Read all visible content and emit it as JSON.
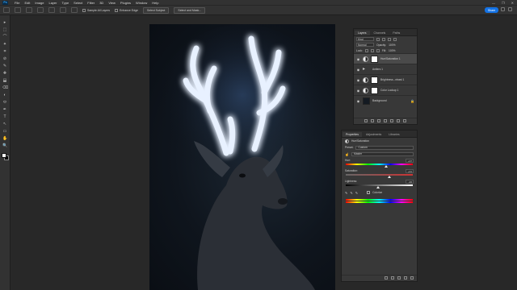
{
  "app": {
    "logo": "Ps"
  },
  "menu": [
    "File",
    "Edit",
    "Image",
    "Layer",
    "Type",
    "Select",
    "Filter",
    "3D",
    "View",
    "Plugins",
    "Window",
    "Help"
  ],
  "window_controls": [
    "—",
    "❐",
    "✕"
  ],
  "options_bar": {
    "sample_all_layers": "Sample All Layers",
    "enhance_edge": "Enhance Edge",
    "select_subject": "Select Subject",
    "select_and_mask": "Select and Mask...",
    "share": "Share"
  },
  "tools": [
    "▸",
    "⬚",
    "⌒",
    "✦",
    "⌗",
    "⊘",
    "✎",
    "✚",
    "⬓",
    "⌫",
    "◐",
    "⬭",
    "✒",
    "T",
    "↖",
    "▭",
    "✋",
    "🔍"
  ],
  "layers_panel": {
    "tabs": [
      "Layers",
      "Channels",
      "Paths"
    ],
    "kind_label": "Kind",
    "blend_mode": "Normal",
    "opacity_label": "Opacity:",
    "opacity_value": "100%",
    "lock_label": "Lock:",
    "fill_label": "Fill:",
    "fill_value": "100%",
    "layers": [
      {
        "name": "Hue/Saturation 1",
        "type": "adjustment",
        "active": true
      },
      {
        "name": "Antlers 1",
        "type": "group"
      },
      {
        "name": "Brightness...ntrast 1",
        "type": "adjustment"
      },
      {
        "name": "Color Lookup 1",
        "type": "adjustment"
      },
      {
        "name": "Background",
        "type": "image",
        "locked": true
      }
    ]
  },
  "properties_panel": {
    "tabs": [
      "Properties",
      "Adjustments",
      "Libraries"
    ],
    "title": "Hue/Saturation",
    "preset_label": "Preset:",
    "preset_value": "Custom",
    "channel_value": "Master",
    "hue_label": "Hue:",
    "hue_value": "+37",
    "hue_knob_percent": 60,
    "saturation_label": "Saturation:",
    "saturation_value": "+31",
    "saturation_knob_percent": 65,
    "lightness_label": "Lightness:",
    "lightness_value": "-46",
    "lightness_knob_percent": 48,
    "colorize_label": "Colorize"
  }
}
